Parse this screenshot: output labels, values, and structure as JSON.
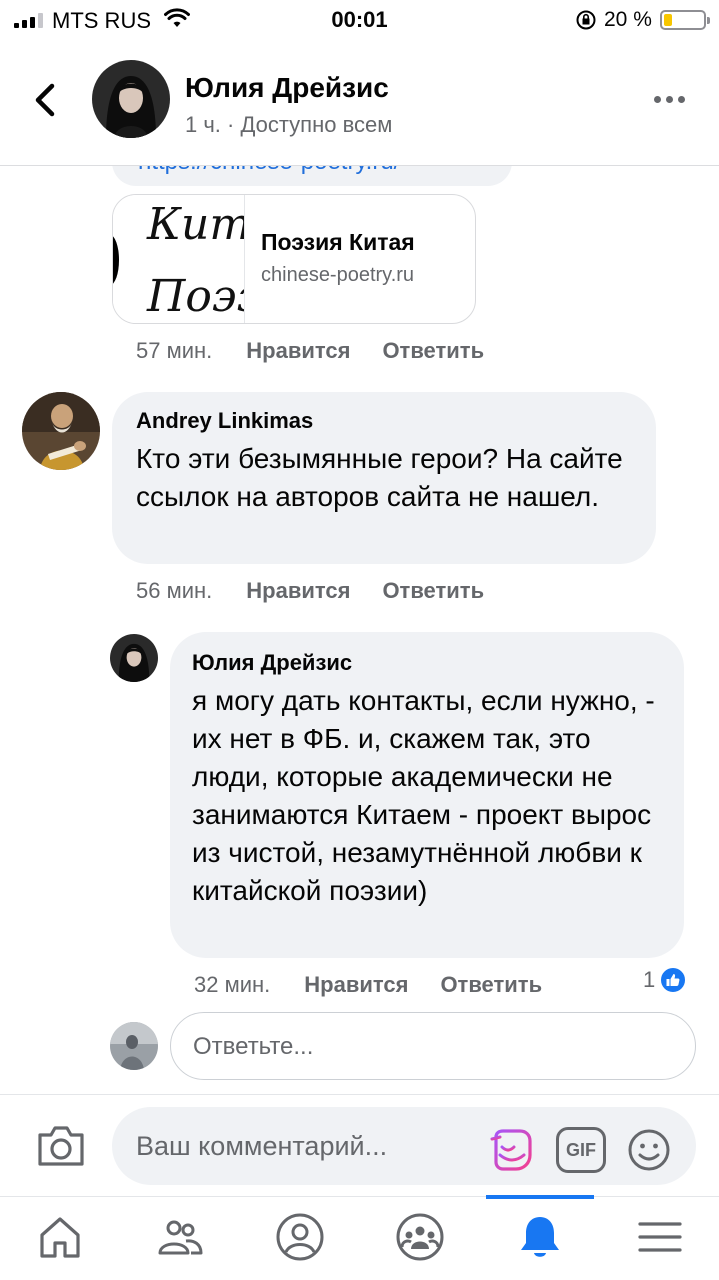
{
  "status_bar": {
    "carrier": "MTS RUS",
    "time": "00:01",
    "battery_percent": "20 %",
    "battery_level": 0.2
  },
  "header": {
    "author_name": "Юлия Дрейзис",
    "meta": "1 ч. · Доступно всем"
  },
  "thread": {
    "link_preview": {
      "url_text": "https://chinese-poetry.ru/",
      "thumb_line1": "Кита",
      "thumb_line2": "Поэзи",
      "title": "Поэзия Китая",
      "domain": "chinese-poetry.ru",
      "time": "57 мин.",
      "like_label": "Нравится",
      "reply_label": "Ответить"
    },
    "comments": [
      {
        "author": "Andrey Linkimas",
        "text": "Кто эти безымянные герои? На сайте ссылок на авторов сайта не нашел.",
        "time": "56 мин.",
        "like_label": "Нравится",
        "reply_label": "Ответить"
      },
      {
        "author": "Юлия Дрейзис",
        "text": "я могу дать контакты, если нужно, - их нет в ФБ. и, скажем так, это люди, которые академически не занимаются Китаем - проект вырос из чистой, незамутнённой любви к китайской поэзии)",
        "time": "32 мин.",
        "like_label": "Нравится",
        "reply_label": "Ответить",
        "reaction_count": "1"
      }
    ],
    "reply_placeholder": "Ответьте..."
  },
  "composer": {
    "placeholder": "Ваш комментарий...",
    "gif_label": "GIF"
  },
  "tabbar": {
    "active_tab": "notifications"
  },
  "colors": {
    "accent": "#1877f2",
    "link": "#216fdb",
    "bubble": "#f0f2f5",
    "muted_text": "#65676b",
    "battery_fill": "#f7c600"
  }
}
